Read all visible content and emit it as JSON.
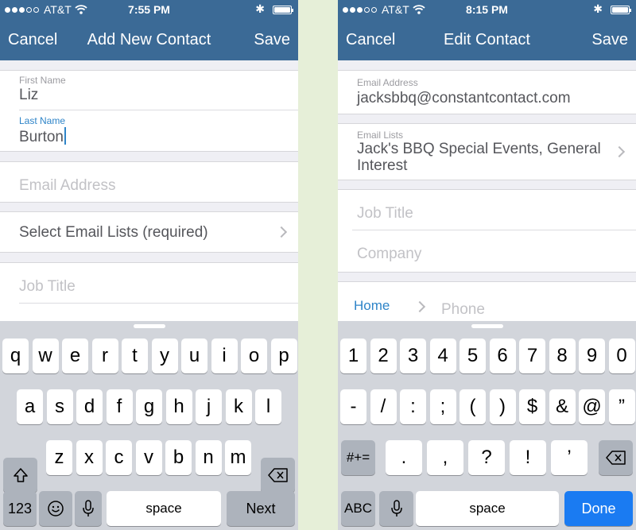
{
  "left": {
    "status": {
      "carrier": "AT&T",
      "time": "7:55 PM"
    },
    "nav": {
      "cancel": "Cancel",
      "title": "Add New Contact",
      "save": "Save"
    },
    "first_name": {
      "label": "First Name",
      "value": "Liz"
    },
    "last_name": {
      "label": "Last Name",
      "value": "Burton"
    },
    "email_placeholder": "Email Address",
    "email_lists": "Select Email Lists (required)",
    "job_title_placeholder": "Job Title",
    "keyboard": {
      "row1": [
        "q",
        "w",
        "e",
        "r",
        "t",
        "y",
        "u",
        "i",
        "o",
        "p"
      ],
      "row2": [
        "a",
        "s",
        "d",
        "f",
        "g",
        "h",
        "j",
        "k",
        "l"
      ],
      "row3": [
        "z",
        "x",
        "c",
        "v",
        "b",
        "n",
        "m"
      ],
      "num_key": "123",
      "space": "space",
      "next": "Next"
    }
  },
  "right": {
    "status": {
      "carrier": "AT&T",
      "time": "8:15 PM"
    },
    "nav": {
      "cancel": "Cancel",
      "title": "Edit Contact",
      "save": "Save"
    },
    "email": {
      "label": "Email Address",
      "value": "jacksbbq@constantcontact.com"
    },
    "email_lists": {
      "label": "Email Lists",
      "line1": "Jack's BBQ Special Events, General",
      "line2": "Interest"
    },
    "job_title_placeholder": "Job Title",
    "company_placeholder": "Company",
    "phone": {
      "type": "Home",
      "placeholder": "Phone"
    },
    "keyboard": {
      "row1": [
        "1",
        "2",
        "3",
        "4",
        "5",
        "6",
        "7",
        "8",
        "9",
        "0"
      ],
      "row2": [
        "-",
        "/",
        ":",
        ";",
        "(",
        ")",
        "$",
        "&",
        "@",
        "”"
      ],
      "row3": [
        ".",
        ",",
        "?",
        "!",
        "’"
      ],
      "sym_key": "#+=",
      "abc_key": "ABC",
      "space": "space",
      "done": "Done"
    }
  }
}
